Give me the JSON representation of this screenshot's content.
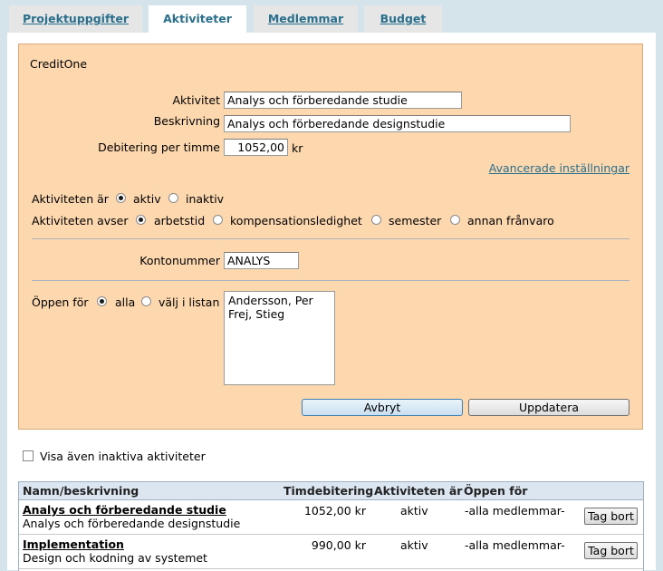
{
  "tabs": [
    {
      "label": "Projektuppgifter"
    },
    {
      "label": "Aktiviteter"
    },
    {
      "label": "Medlemmar"
    },
    {
      "label": "Budget"
    }
  ],
  "form": {
    "company": "CreditOne",
    "activity_label": "Aktivitet",
    "activity_value": "Analys och förberedande studie",
    "description_label": "Beskrivning",
    "description_value": "Analys och förberedande designstudie",
    "rate_label": "Debitering per timme",
    "rate_value": "1052,00",
    "rate_unit": "kr",
    "advanced_link": "Avancerade inställningar",
    "status_label": "Aktiviteten är",
    "status_options": [
      {
        "label": "aktiv",
        "selected": true
      },
      {
        "label": "inaktiv",
        "selected": false
      }
    ],
    "type_label": "Aktiviteten avser",
    "type_options": [
      {
        "label": "arbetstid",
        "selected": true
      },
      {
        "label": "kompensationsledighet",
        "selected": false
      },
      {
        "label": "semester",
        "selected": false
      },
      {
        "label": "annan frånvaro",
        "selected": false
      }
    ],
    "account_label": "Kontonummer",
    "account_value": "ANALYS",
    "open_label": "Öppen för",
    "open_options": [
      {
        "label": "alla",
        "selected": true
      },
      {
        "label": "välj i listan",
        "selected": false
      }
    ],
    "members": [
      "Andersson, Per",
      "Frej, Stieg"
    ],
    "cancel_label": "Avbryt",
    "update_label": "Uppdatera"
  },
  "show_inactive": {
    "label": "Visa även inaktiva aktiviteter",
    "checked": false
  },
  "table": {
    "headers": [
      "Namn/beskrivning",
      "Timdebitering",
      "Aktiviteten är",
      "Öppen för"
    ],
    "rows": [
      {
        "name": "Analys och förberedande studie",
        "description": "Analys och förberedande designstudie",
        "rate": "1052,00 kr",
        "status": "aktiv",
        "open": "-alla medlemmar-",
        "action": "Tag bort"
      },
      {
        "name": "Implementation",
        "description": "Design och kodning av systemet",
        "rate": "990,00 kr",
        "status": "aktiv",
        "open": "-alla medlemmar-",
        "action": "Tag bort"
      }
    ]
  }
}
